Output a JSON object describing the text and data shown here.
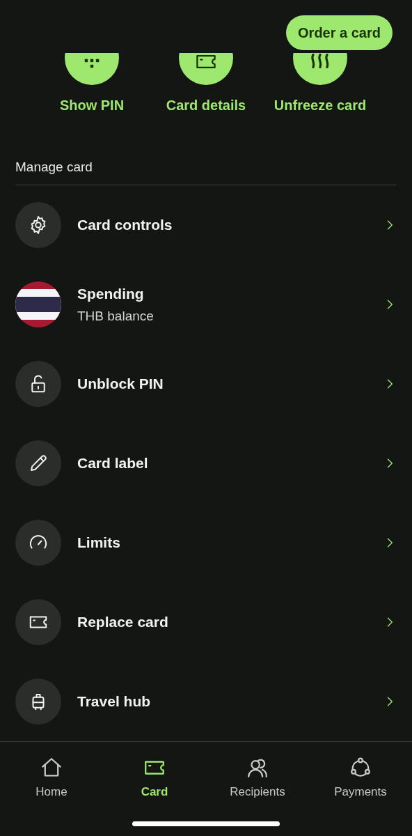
{
  "order_button": "Order a card",
  "actions": [
    {
      "label": "Show PIN"
    },
    {
      "label": "Card details"
    },
    {
      "label": "Unfreeze card"
    }
  ],
  "section_title": "Manage card",
  "rows": [
    {
      "kind": "icon",
      "title": "Card controls"
    },
    {
      "kind": "flag",
      "title": "Spending",
      "subtitle": "THB balance"
    },
    {
      "kind": "icon",
      "title": "Unblock PIN"
    },
    {
      "kind": "icon",
      "title": "Card label"
    },
    {
      "kind": "icon",
      "title": "Limits"
    },
    {
      "kind": "icon",
      "title": "Replace card"
    },
    {
      "kind": "icon",
      "title": "Travel hub"
    }
  ],
  "nav": [
    {
      "label": "Home",
      "selected": false
    },
    {
      "label": "Card",
      "selected": true
    },
    {
      "label": "Recipients",
      "selected": false
    },
    {
      "label": "Payments",
      "selected": false
    }
  ]
}
